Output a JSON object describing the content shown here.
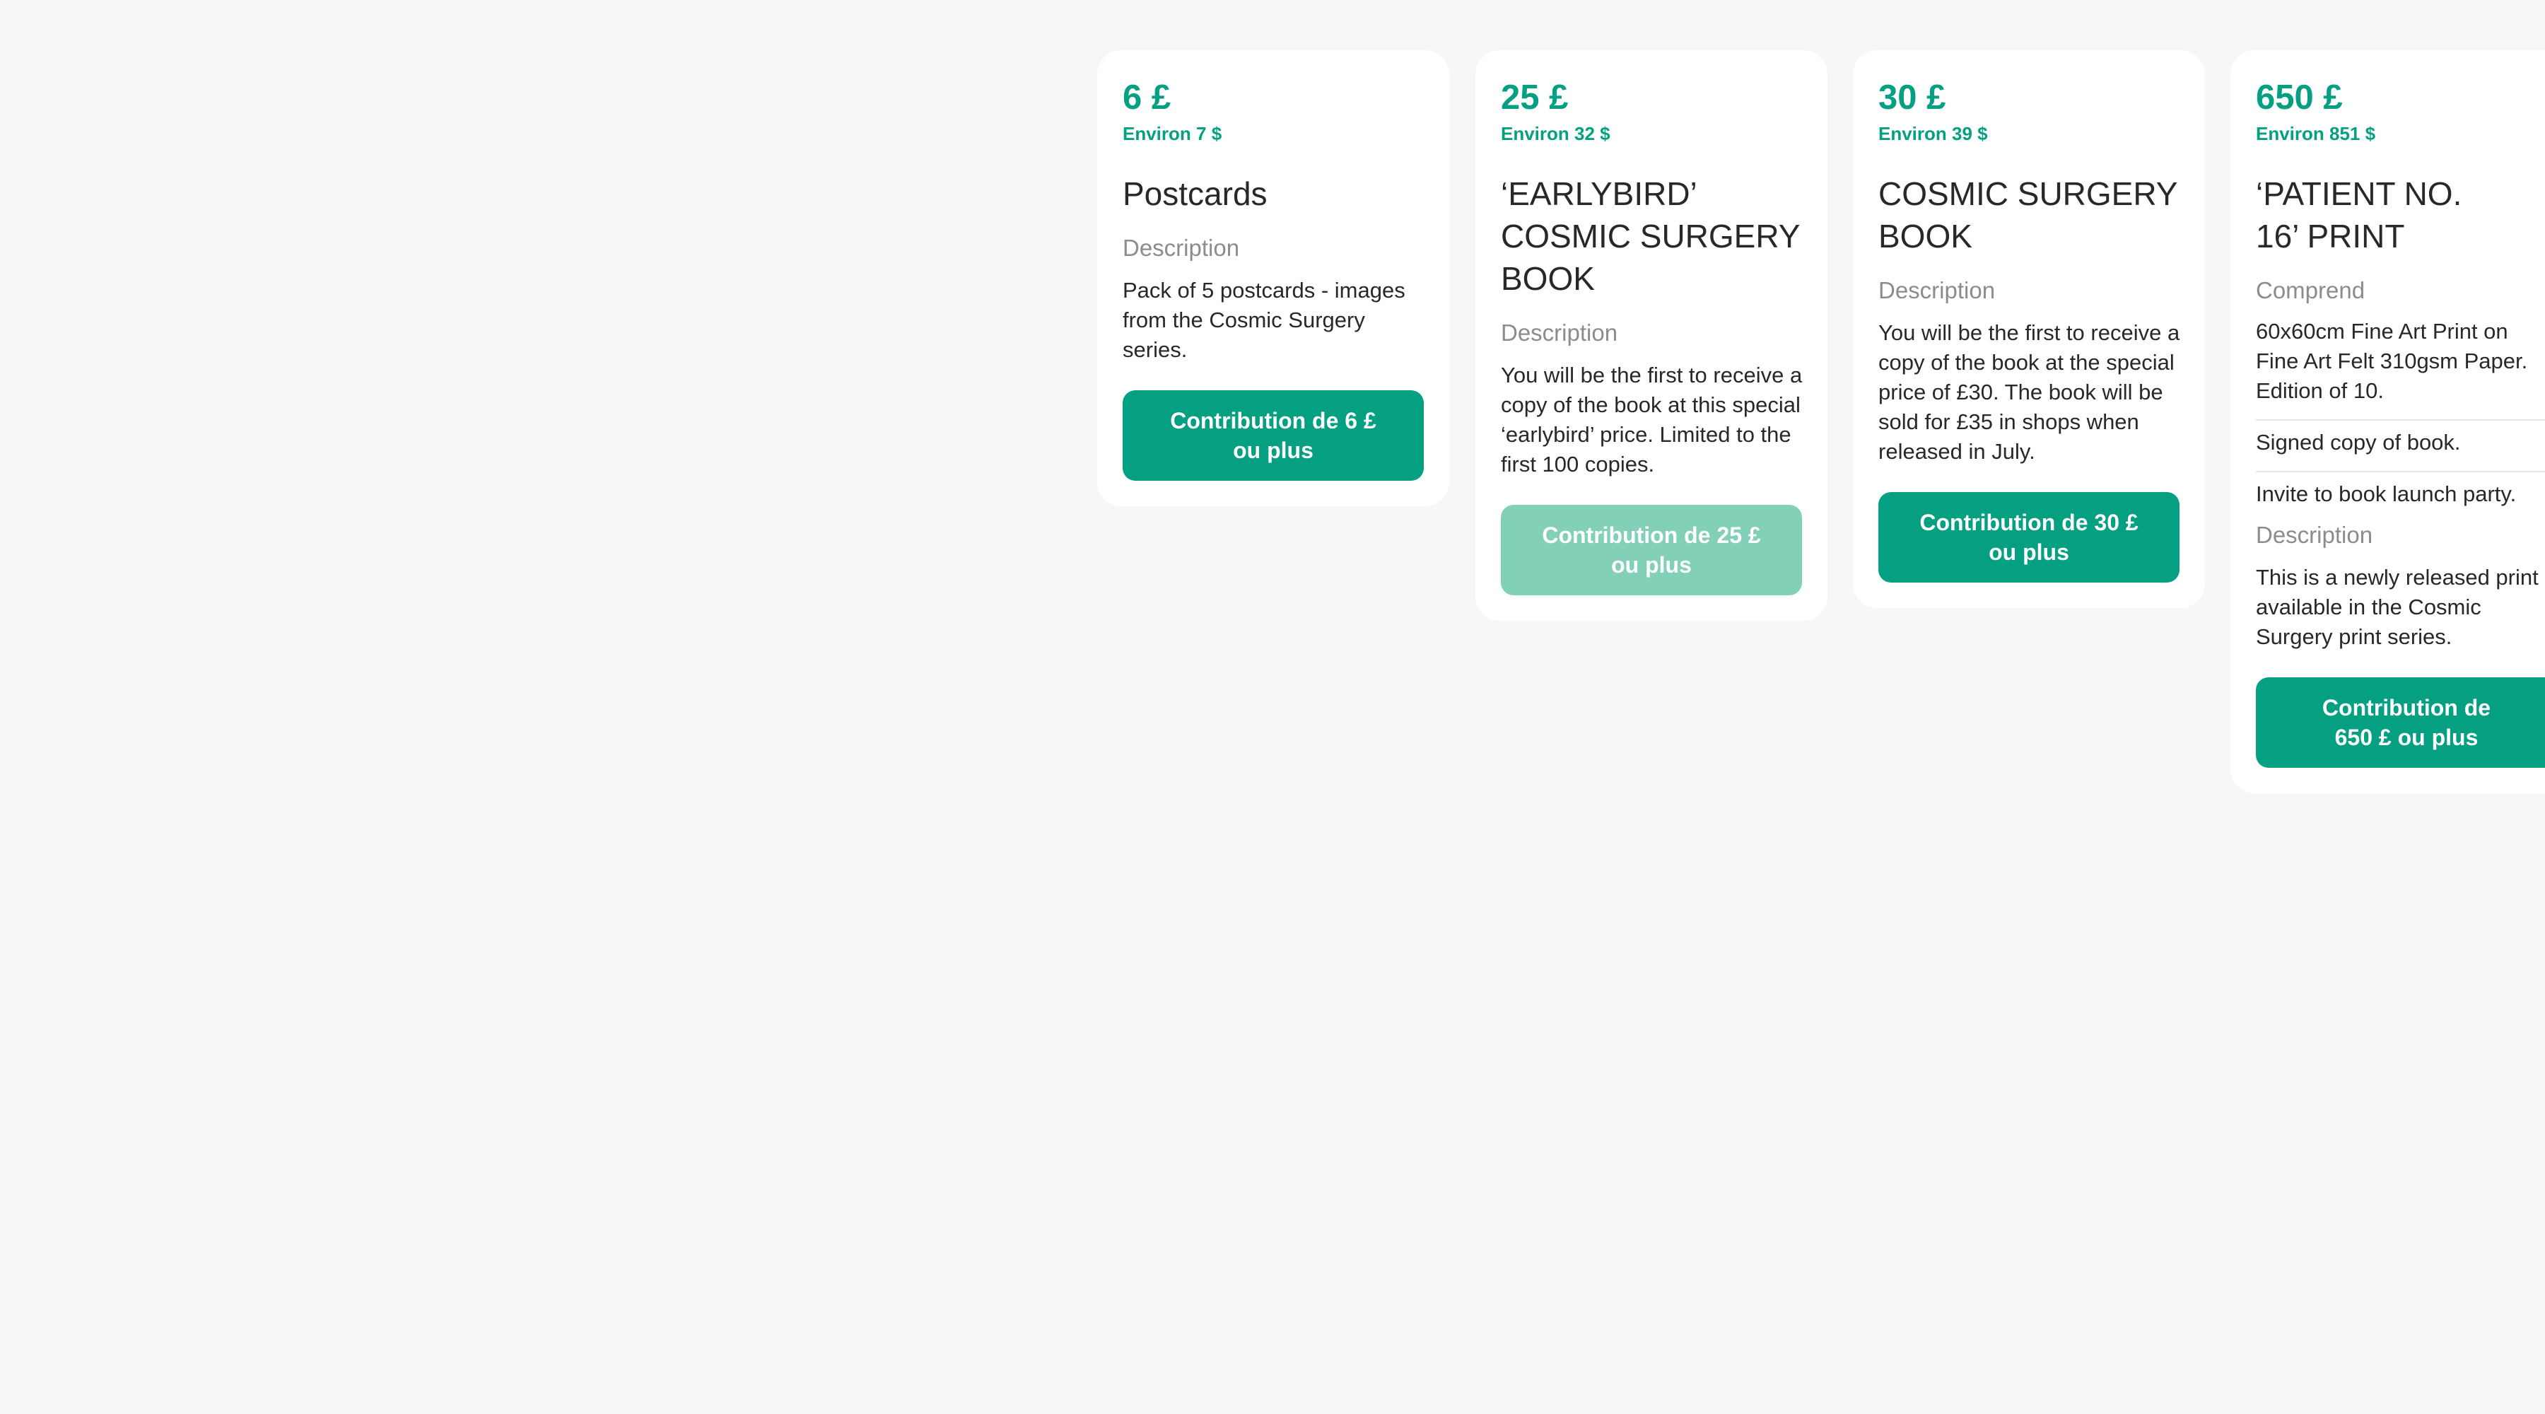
{
  "rewards": [
    {
      "price": "6 £",
      "approx": "Environ 7 $",
      "title": "Postcards",
      "description_label": "Description",
      "description": "Pack of 5 postcards - images from the Cosmic Surgery series.",
      "cta_label": "Contribution de 6 £\nou plus",
      "cta_disabled": false
    },
    {
      "price": "25 £",
      "approx": "Environ 32 $",
      "title": "‘EARLYBIRD’ COSMIC SURGERY BOOK",
      "description_label": "Description",
      "description": "You will be the first to receive a copy of the book at this special ‘earlybird’ price. Limited to the first 100 copies.",
      "cta_label": "Contribution de 25 £\nou plus",
      "cta_disabled": true
    },
    {
      "price": "30 £",
      "approx": "Environ 39 $",
      "title": "COSMIC SURGERY BOOK",
      "description_label": "Description",
      "description": "You will be the first to receive a copy of the book at the special price of £30. The book will be sold for £35 in shops when released in July.",
      "cta_label": "Contribution de 30 £\nou plus",
      "cta_disabled": false
    },
    {
      "price": "650 £",
      "approx": "Environ 851 $",
      "title": "‘PATIENT NO. 16’ PRINT",
      "includes_label": "Comprend",
      "includes": [
        "60x60cm Fine Art Print on Fine Art Felt 310gsm Paper. Edition of 10.",
        "Signed copy of book.",
        "Invite to book launch party."
      ],
      "description_label": "Description",
      "description": "This is a newly released print available in the Cosmic Surgery print series.",
      "cta_label": "Contribution de\n650 £ ou plus",
      "cta_disabled": false
    }
  ]
}
